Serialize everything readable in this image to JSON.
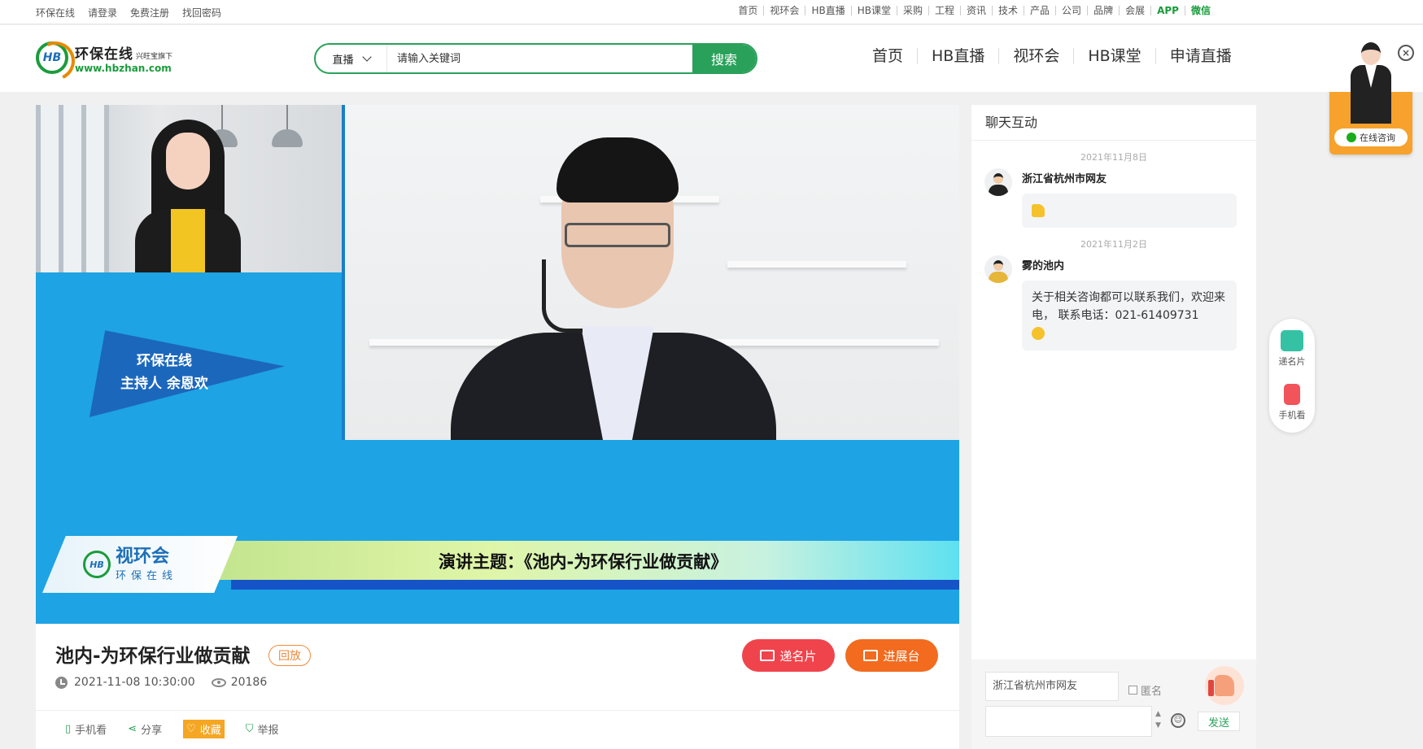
{
  "topbar": {
    "left_links": [
      "环保在线",
      "请登录",
      "免费注册",
      "找回密码"
    ],
    "right_links": [
      "首页",
      "视环会",
      "HB直播",
      "HB课堂",
      "采购",
      "工程",
      "资讯",
      "技术",
      "产品",
      "公司",
      "品牌",
      "会展"
    ],
    "app": "APP",
    "wechat": "微信"
  },
  "header": {
    "logo_mark": "HB",
    "logo_name": "环保在线",
    "logo_sub": "兴旺宝旗下",
    "logo_url": "www.hbzhan.com",
    "search_scope": "直播",
    "search_placeholder": "请输入关键词",
    "search_button": "搜索",
    "nav": [
      "首页",
      "HB直播",
      "视环会",
      "HB课堂",
      "申请直播"
    ]
  },
  "consult": {
    "label": "在线咨询",
    "close": "×"
  },
  "video": {
    "host_line1": "环保在线",
    "host_line2": "主持人 余恩欢",
    "banner_brand": "视环会",
    "banner_brand_sub": "环保在线",
    "topic": "演讲主题：《池内-为环保行业做贡献》"
  },
  "info": {
    "title": "池内-为环保行业做贡献",
    "tag": "回放",
    "datetime": "2021-11-08 10:30:00",
    "views": "20186",
    "card_button": "递名片",
    "expo_button": "进展台",
    "actions": {
      "mobile": "手机看",
      "share": "分享",
      "favorite": "收藏",
      "report": "举报"
    }
  },
  "chat": {
    "title": "聊天互动",
    "messages": [
      {
        "date": "2021年11月8日",
        "name": "浙江省杭州市网友",
        "text": ""
      },
      {
        "date": "2021年11月2日",
        "name": "雾的池内",
        "text": "关于相关咨询都可以联系我们，欢迎来电， 联系电话：021-61409731"
      }
    ],
    "nickname": "浙江省杭州市网友",
    "anonymous": "匿名",
    "send": "发送"
  },
  "sidetools": {
    "card": "递名片",
    "mobile": "手机看"
  }
}
